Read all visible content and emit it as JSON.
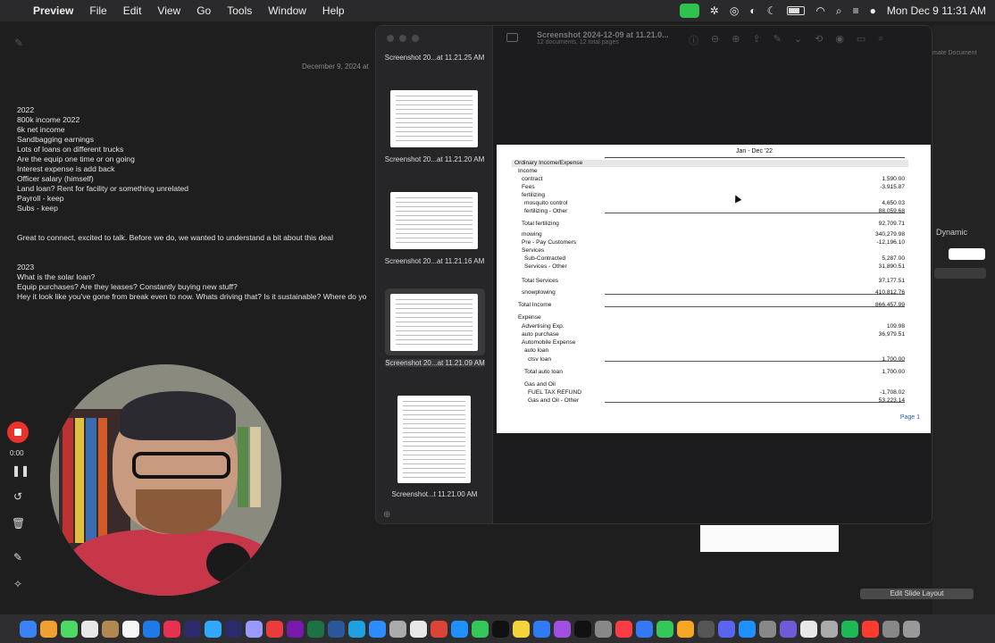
{
  "menubar": {
    "app": "Preview",
    "items": [
      "File",
      "Edit",
      "View",
      "Go",
      "Tools",
      "Window",
      "Help"
    ],
    "clock": "Mon Dec 9  11:31 AM"
  },
  "notes": {
    "date": "December 9, 2024 at",
    "lines": [
      "2022",
      "800k income 2022",
      "6k net income",
      "Sandbagging earnings",
      "Lots of loans on different trucks",
      "Are the equip one time or on going",
      "Interest expense is add back",
      "Officer salary (himself)",
      "Land loan? Rent for facility or something unrelated",
      "Payroll - keep",
      "Subs - keep",
      "",
      "",
      "Great to connect, excited to talk. Before we do, we wanted to understand a bit about this deal",
      "",
      "",
      "2023",
      "What is the solar loan?",
      "Equip purchases? Are they leases? Constantly buying new stuff?",
      "Hey it look like you've gone from break even to now. Whats driving that? Is it sustainable? Where do yo"
    ]
  },
  "preview": {
    "title": "Screenshot 2024-12-09 at 11.21.0...",
    "subtitle": "12 documents, 12 total pages",
    "thumbnails": [
      {
        "label": "Screenshot 20...at 11.21.25 AM",
        "selected": false
      },
      {
        "label": "Screenshot 20...at 11.21.20 AM",
        "selected": false
      },
      {
        "label": "Screenshot 20...at 11.21.16 AM",
        "selected": false
      },
      {
        "label": "Screenshot 20...at 11.21.09 AM",
        "selected": true
      },
      {
        "label": "Screenshot...t 11.21.00 AM",
        "selected": false
      }
    ],
    "document": {
      "period": "Jan - Dec '22",
      "section": "Ordinary Income/Expense",
      "rows": [
        {
          "label": "Income",
          "value": "",
          "indent": 1
        },
        {
          "label": "contract",
          "value": "1,590.00",
          "indent": 2
        },
        {
          "label": "Fees",
          "value": "-3,915.87",
          "indent": 2
        },
        {
          "label": "fertilizing",
          "value": "",
          "indent": 2
        },
        {
          "label": "mosquito control",
          "value": "4,650.03",
          "indent": 3
        },
        {
          "label": "fertilizing - Other",
          "value": "88,059.68",
          "indent": 3
        },
        {
          "label": "Total fertilizing",
          "value": "92,709.71",
          "indent": 2
        },
        {
          "label": "mowing",
          "value": "340,279.98",
          "indent": 2
        },
        {
          "label": "Pre - Pay Customers",
          "value": "-12,196.10",
          "indent": 2
        },
        {
          "label": "Services",
          "value": "",
          "indent": 2
        },
        {
          "label": "Sub-Contracted",
          "value": "5,287.00",
          "indent": 3
        },
        {
          "label": "Services - Other",
          "value": "31,890.51",
          "indent": 3
        },
        {
          "label": "Total Services",
          "value": "37,177.51",
          "indent": 2
        },
        {
          "label": "snowplowing",
          "value": "410,812.76",
          "indent": 2
        },
        {
          "label": "Total Income",
          "value": "866,457.99",
          "indent": 1
        },
        {
          "label": "Expense",
          "value": "",
          "indent": 1
        },
        {
          "label": "Advertising Exp.",
          "value": "109.98",
          "indent": 2
        },
        {
          "label": "auto purchase",
          "value": "36,979.51",
          "indent": 2
        },
        {
          "label": "Automobile Expense",
          "value": "",
          "indent": 2
        },
        {
          "label": "auto loan",
          "value": "",
          "indent": 3
        },
        {
          "label": "ctsv loan",
          "value": "1,700.00",
          "indent": 4
        },
        {
          "label": "Total auto loan",
          "value": "1,700.00",
          "indent": 3
        },
        {
          "label": "Gas and Oil",
          "value": "",
          "indent": 3
        },
        {
          "label": "FUEL TAX REFUND",
          "value": "-1,708.02",
          "indent": 4
        },
        {
          "label": "Gas and Oil - Other",
          "value": "53,223.14",
          "indent": 4
        }
      ],
      "page_label": "Page 1"
    }
  },
  "keynote": {
    "top_labels": "mate     Document",
    "dynamic": "Dynamic",
    "edit_layout": "Edit Slide Layout"
  },
  "recorder": {
    "time": "0:00"
  }
}
